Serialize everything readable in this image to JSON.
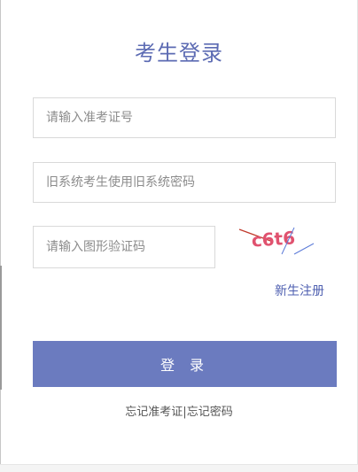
{
  "login": {
    "title": "考生登录",
    "exam_id_placeholder": "请输入准考证号",
    "password_placeholder": "旧系统考生使用旧系统密码",
    "captcha_placeholder": "请输入图形验证码",
    "captcha_text": "c6t6",
    "register_link": "新生注册",
    "submit_label": "登 录",
    "forgot_exam_id": "忘记准考证",
    "separator": "|",
    "forgot_password": "忘记密码"
  },
  "colors": {
    "accent": "#5c6bb3",
    "button": "#6b7bbf",
    "captcha_text": "#e0526f",
    "captcha_line_red": "#c0392b",
    "captcha_line_blue": "#5c7bd8"
  }
}
